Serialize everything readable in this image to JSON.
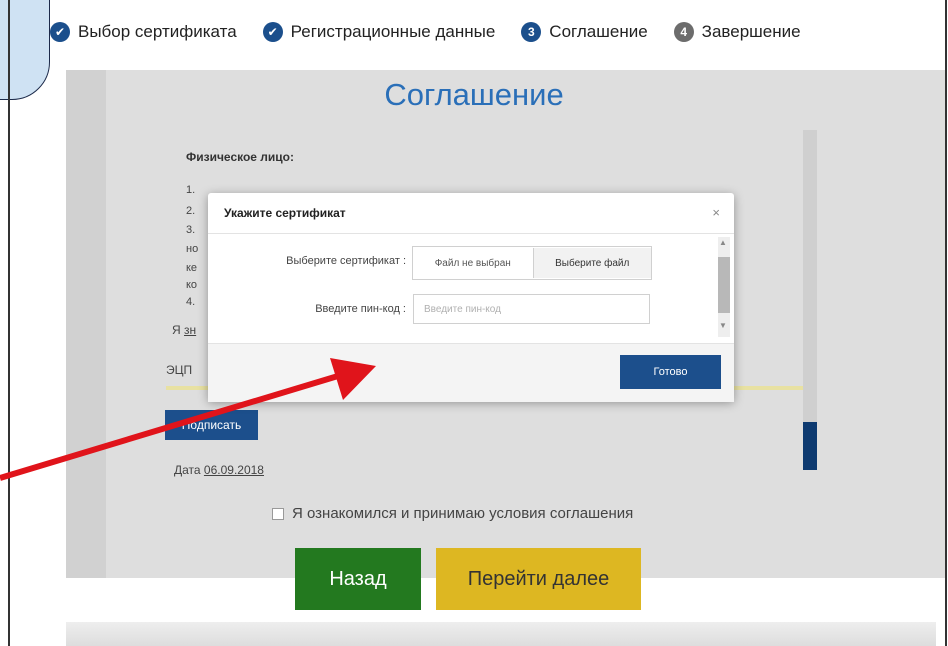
{
  "steps": [
    {
      "label": "Выбор сертификата",
      "icon": "check-circle-icon",
      "mark": "✔"
    },
    {
      "label": "Регистрационные данные",
      "icon": "check-circle-icon",
      "mark": "✔"
    },
    {
      "label": "Соглашение",
      "icon": "number-circle-icon",
      "mark": "3"
    },
    {
      "label": "Завершение",
      "icon": "number-circle-icon",
      "mark": "4"
    }
  ],
  "page": {
    "title": "Соглашение",
    "individual_label": "Физическое лицо:",
    "list_lines": [
      "1.",
      "2.",
      "3.",
      "но",
      "ке",
      "ко",
      "4."
    ],
    "ya_text": "Я",
    "ya_link": "зн",
    "ecp_label": "ЭЦП",
    "sign_button": "Подписать",
    "date_label": "Дата",
    "date_value": "06.09.2018",
    "agree_text": "Я ознакомился и принимаю условия соглашения",
    "back_button": "Назад",
    "next_button": "Перейти далее"
  },
  "modal": {
    "title": "Укажите сертификат",
    "close_glyph": "×",
    "cert_label": "Выберите сертификат :",
    "file_status": "Файл не выбран",
    "file_button": "Выберите файл",
    "pin_label": "Введите пин-код :",
    "pin_placeholder": "Введите пин-код",
    "done_button": "Готово"
  },
  "colors": {
    "accent_blue": "#1c4f8c",
    "title_blue": "#2a6fb8",
    "back_green": "#23791f",
    "next_yellow": "#ddb722",
    "arrow_red": "#e0141b",
    "callout_fill": "#cfe2f3"
  }
}
